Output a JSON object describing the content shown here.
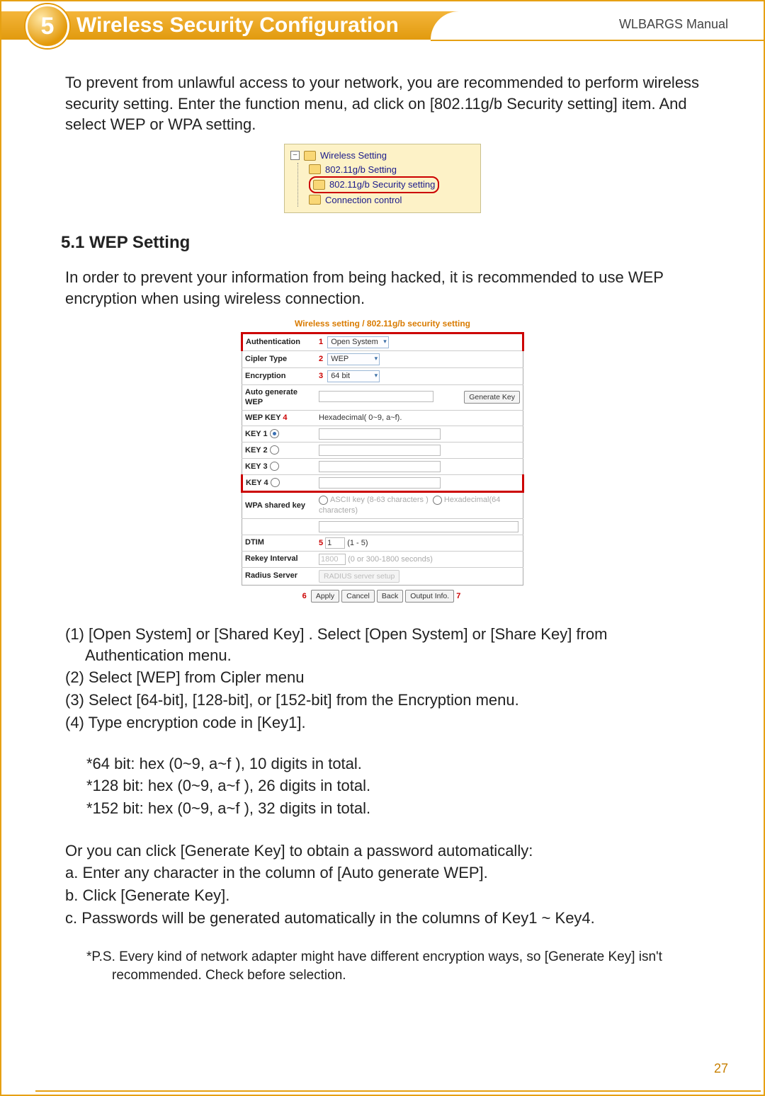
{
  "header": {
    "chapter_number": "5",
    "title": "Wireless Security Configuration",
    "manual_label": "WLBARGS Manual"
  },
  "intro_text": "To prevent from unlawful access to your network, you are recommended to perform wireless security setting. Enter the function menu, ad click on [802.11g/b Security setting] item. And select WEP or WPA setting.",
  "tree": {
    "root": "Wireless Setting",
    "items": [
      "802.11g/b Setting",
      "802.11g/b Security setting",
      "Connection control"
    ],
    "highlight_index": 1
  },
  "section": {
    "heading": "5.1 WEP Setting",
    "body": "In order to prevent your information from being hacked, it is recommended to use WEP encryption when using wireless connection."
  },
  "panel": {
    "breadcrumb": "Wireless setting / 802.11g/b security setting",
    "rows": {
      "authentication": {
        "label": "Authentication",
        "num": "1",
        "value": "Open System"
      },
      "cipher": {
        "label": "Cipler Type",
        "num": "2",
        "value": "WEP"
      },
      "encryption": {
        "label": "Encryption",
        "num": "3",
        "value": "64 bit"
      },
      "autogen": {
        "label": "Auto generate WEP",
        "button": "Generate Key"
      },
      "wepkey": {
        "label": "WEP KEY",
        "num": "4",
        "hint": "Hexadecimal( 0~9, a~f)."
      },
      "keys": [
        "KEY 1",
        "KEY 2",
        "KEY 3",
        "KEY 4"
      ],
      "wpa": {
        "label": "WPA shared key",
        "opt1": "ASCII key (8-63 characters )",
        "opt2": "Hexadecimal(64 characters)"
      },
      "dtim": {
        "label": "DTIM",
        "num": "5",
        "value": "1",
        "hint": "(1 - 5)"
      },
      "rekey": {
        "label": "Rekey Interval",
        "value": "1800",
        "hint": "(0 or 300-1800 seconds)"
      },
      "radius": {
        "label": "Radius Server",
        "button": "RADIUS server setup"
      }
    },
    "actions": {
      "num_left": "6",
      "apply": "Apply",
      "cancel": "Cancel",
      "back": "Back",
      "output": "Output Info.",
      "num_right": "7"
    }
  },
  "steps": [
    "(1) [Open System] or [Shared Key] . Select [Open System] or [Share Key] from Authentication menu.",
    "(2) Select [WEP] from Cipler menu",
    "(3) Select [64-bit], [128-bit], or [152-bit] from the Encryption menu.",
    "(4) Type encryption code in [Key1]."
  ],
  "bit_notes": [
    "*64 bit: hex (0~9, a~f ), 10 digits in total.",
    "*128 bit: hex (0~9, a~f ), 26 digits in total.",
    "*152 bit: hex (0~9, a~f ), 32 digits in total."
  ],
  "auto_gen": [
    "Or you can click [Generate Key] to obtain a password automatically:",
    "a. Enter any character in the column of [Auto generate WEP].",
    "b. Click [Generate Key].",
    "c. Passwords will be generated automatically in the columns of Key1 ~ Key4."
  ],
  "ps_note": "*P.S. Every kind of network adapter might have different encryption ways, so [Generate Key] isn't recommended. Check before selection.",
  "page_number": "27"
}
